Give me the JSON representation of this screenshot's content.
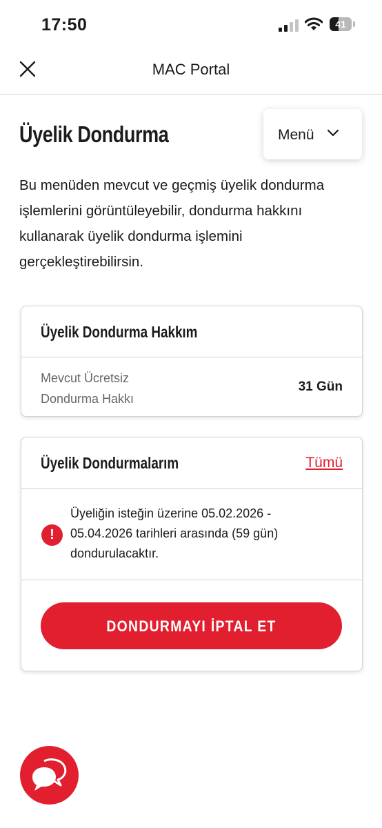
{
  "status_bar": {
    "time": "17:50",
    "battery": "41",
    "battery_level": 0.41
  },
  "nav": {
    "title": "MAC Portal",
    "close_icon": "close-icon"
  },
  "page": {
    "title": "Üyelik Dondurma",
    "menu_label": "Menü",
    "intro": "Bu menüden mevcut ve geçmiş üyelik dondurma işlemlerini görüntüleyebilir, dondurma hakkını kullanarak üyelik dondurma işlemini gerçekleştirebilirsin."
  },
  "quota_card": {
    "title": "Üyelik Dondurma Hakkım",
    "label": "Mevcut Ücretsiz Dondurma Hakkı",
    "value": "31 Gün"
  },
  "freeze_card": {
    "title": "Üyelik Dondurmalarım",
    "all_link": "Tümü",
    "notice": "Üyeliğin isteğin üzerine 05.02.2026 - 05.04.2026 tarihleri arasında (59 gün) dondurulacaktır.",
    "alert_symbol": "!",
    "cancel_button": "DONDURMAYI İPTAL ET"
  },
  "colors": {
    "accent": "#e21f2f",
    "text": "#1b1b1b",
    "muted": "#666666",
    "border": "#d2d2d2"
  },
  "icons": {
    "chat": "chat-bubbles-icon",
    "chevron": "chevron-down-icon",
    "alert": "alert-icon"
  }
}
